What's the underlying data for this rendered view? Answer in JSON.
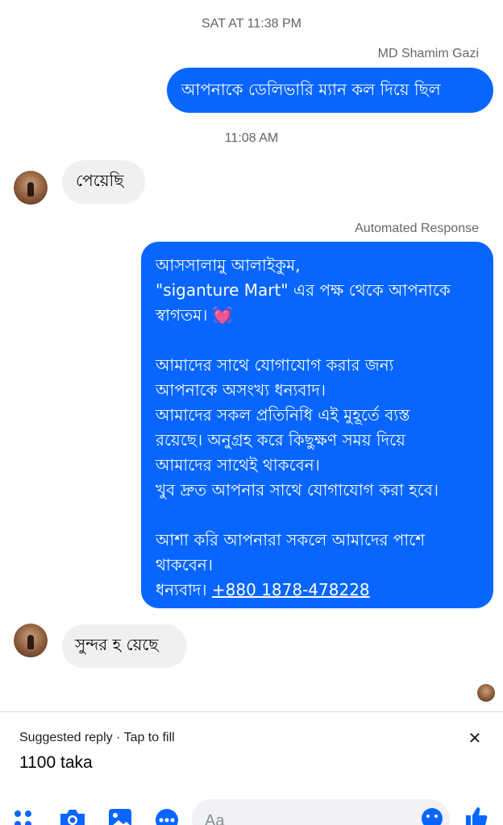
{
  "thread": {
    "timestamp_1": "SAT AT 11:38 PM",
    "sender_1": "MD Shamim Gazi",
    "msg_out_1": "আপনাকে ডেলিভারি ম্যান কল দিয়ে ছিল",
    "timestamp_2": "11:08 AM",
    "msg_in_1": "পেয়েছি",
    "auto_label": "Automated Response",
    "auto_lines": [
      "আসসালামু আলাইকুম,",
      "\"siganture Mart\" এর পক্ষ থেকে আপনাকে",
      "স্বাগতম। ",
      "আমাদের সাথে যোগাযোগ করার জন্য",
      "আপনাকে অসংখ্য ধন্যবাদ।",
      "আমাদের সকল প্রতিনিধি এই মুহূর্তে ব্যস্ত",
      "রয়েছে। অনুগ্রহ করে কিছুক্ষণ সময় দিয়ে",
      "আমাদের সাথেই থাকবেন।",
      "খুব দ্রুত আপনার সাথে যোগাযোগ করা হবে।",
      "আশা করি আপনারা সকলে আমাদের পাশে",
      "থাকবেন।",
      "ধন্যবাদ। "
    ],
    "auto_heart": "💓",
    "auto_phone": "+880 1878-478228",
    "msg_in_2": "সুন্দর হ য়েছে"
  },
  "suggestion": {
    "header": "Suggested reply · Tap to fill",
    "reply": "1100 taka",
    "close_glyph": "✕"
  },
  "composer": {
    "placeholder": "Aa",
    "accent": "#0866ff"
  },
  "icons": [
    "apps-icon",
    "camera-icon",
    "image-icon",
    "more-icon",
    "emoji-icon",
    "like-icon",
    "close-icon",
    "heart-icon"
  ]
}
